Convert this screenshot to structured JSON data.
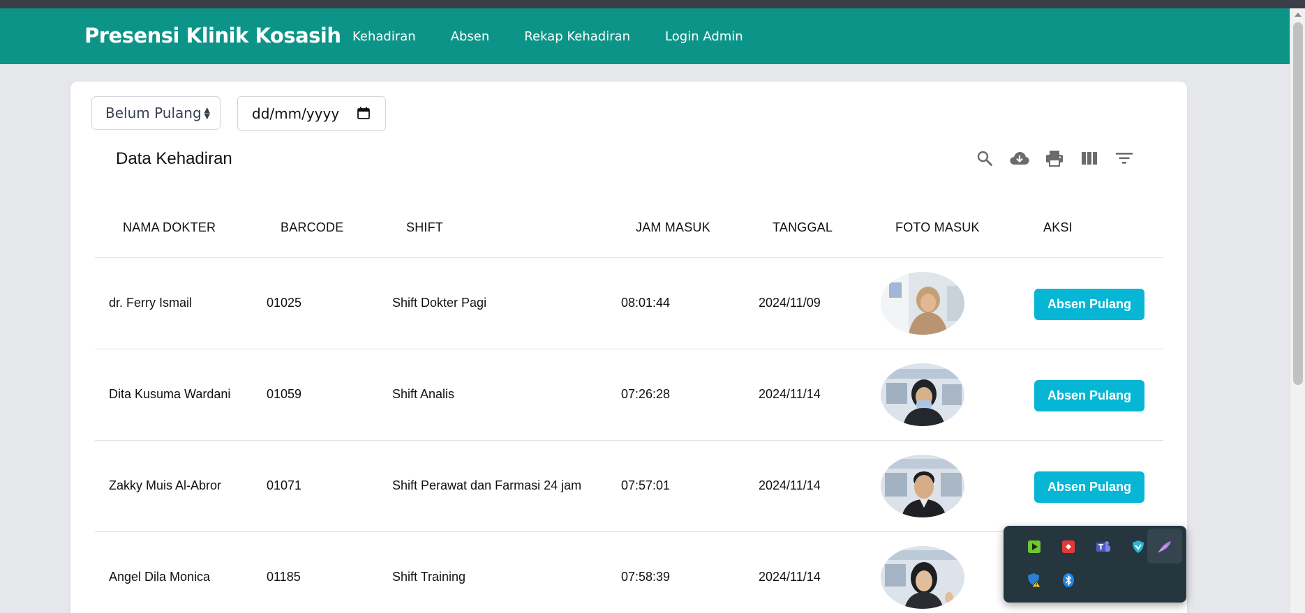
{
  "navbar": {
    "brand": "Presensi Klinik Kosasih",
    "links": [
      "Kehadiran",
      "Absen",
      "Rekap Kehadiran",
      "Login Admin"
    ],
    "color": "#0d9488"
  },
  "filters": {
    "status_select": "Belum Pulang",
    "date_placeholder": "dd/mm/yyyy"
  },
  "table": {
    "title": "Data Kehadiran",
    "tools": [
      "search-icon",
      "download-icon",
      "print-icon",
      "columns-icon",
      "filter-icon"
    ],
    "columns": [
      "NAMA DOKTER",
      "BARCODE",
      "SHIFT",
      "JAM MASUK",
      "TANGGAL",
      "FOTO MASUK",
      "AKSI"
    ],
    "rows": [
      {
        "nama": "dr. Ferry Ismail",
        "barcode": "01025",
        "shift": "Shift Dokter Pagi",
        "jam_masuk": "08:01:44",
        "tanggal": "2024/11/09",
        "aksi": "Absen Pulang"
      },
      {
        "nama": "Dita Kusuma Wardani",
        "barcode": "01059",
        "shift": "Shift Analis",
        "jam_masuk": "07:26:28",
        "tanggal": "2024/11/14",
        "aksi": "Absen Pulang"
      },
      {
        "nama": "Zakky Muis Al-Abror",
        "barcode": "01071",
        "shift": "Shift Perawat dan Farmasi 24 jam",
        "jam_masuk": "07:57:01",
        "tanggal": "2024/11/14",
        "aksi": "Absen Pulang"
      },
      {
        "nama": "Angel Dila Monica",
        "barcode": "01185",
        "shift": "Shift Training",
        "jam_masuk": "07:58:39",
        "tanggal": "2024/11/14",
        "aksi": ""
      }
    ],
    "button_color": "#06b6d4"
  },
  "system_tray": {
    "icons": [
      "nvidia-icon",
      "anydesk-icon",
      "teams-icon",
      "vpn-shield-icon",
      "feather-icon",
      "defender-warning-icon",
      "bluetooth-icon"
    ]
  }
}
